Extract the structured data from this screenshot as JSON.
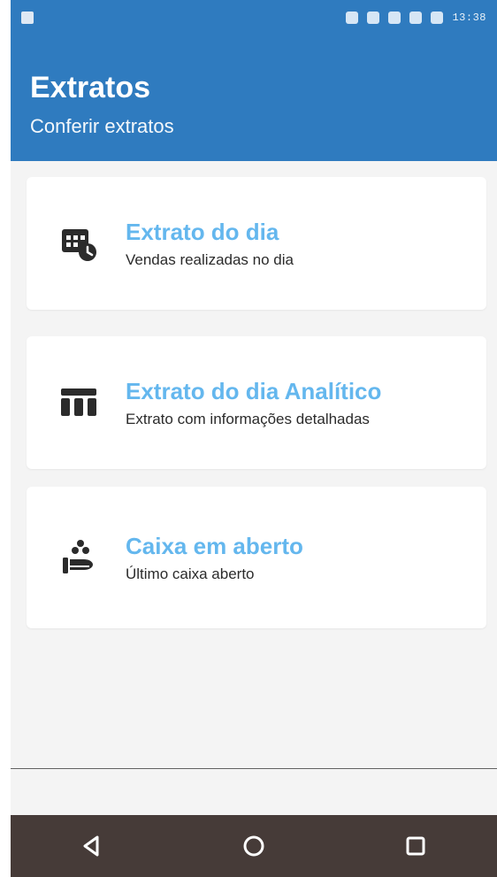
{
  "status_bar": {
    "time": "13:38",
    "icons": [
      "location-icon",
      "bluetooth-icon",
      "wifi-icon",
      "signal-icon",
      "battery-icon",
      "notification-icon"
    ]
  },
  "app_bar": {
    "title": "Extratos",
    "subtitle": "Conferir extratos",
    "color": "#2f7bbf"
  },
  "cards": [
    {
      "title": "Extrato do dia",
      "subtitle": "Vendas realizadas no dia",
      "icon": "calendar-clock-icon"
    },
    {
      "title": "Extrato do dia Analítico",
      "subtitle": "Extrato com informações detalhadas",
      "icon": "table-icon"
    },
    {
      "title": "Caixa em aberto",
      "subtitle": "Último caixa aberto",
      "icon": "hand-coins-icon"
    }
  ],
  "nav": {
    "back_label": "◁",
    "home_label": "○",
    "recent_label": "□"
  },
  "colors": {
    "accent_text": "#64b7ee",
    "card_bg": "#ffffff",
    "navbar_bg": "#463b38"
  }
}
